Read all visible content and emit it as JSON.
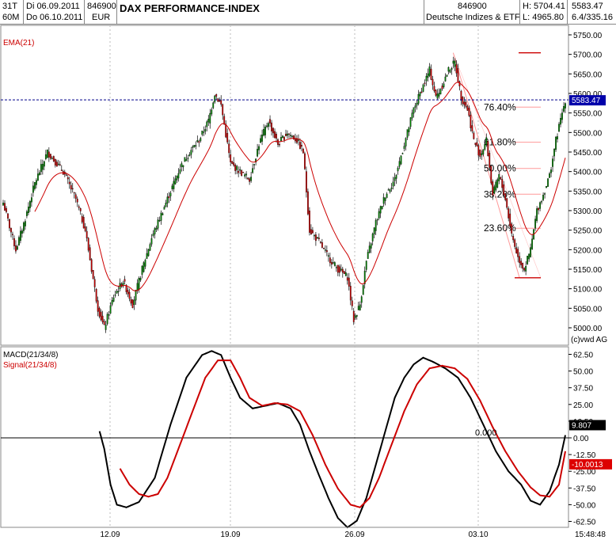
{
  "header": {
    "period": "31T",
    "interval": "60M",
    "date_from": "Di 06.09.2011",
    "date_to": "Do 06.10.2011",
    "wkn_top": "846900",
    "currency": "EUR",
    "title": "DAX PERFORMANCE-INDEX",
    "wkn_right": "846900",
    "group": "Deutsche Indizes & ETF",
    "high": "H: 5704.41",
    "low": "L: 4965.80",
    "close_top": "5583.47",
    "change": "6.4/335.16"
  },
  "copyright": "(c)vwd AG",
  "time": "15:48:48",
  "colors": {
    "up": "#008000",
    "down": "#cc0000",
    "ema": "#cc0000",
    "macd": "#000000",
    "signal": "#cc0000",
    "fib": "#ff9999",
    "last_bg": "#0000aa",
    "signal_bg": "#dd0000"
  },
  "chart_data": [
    {
      "type": "candlestick",
      "title": "DAX PERFORMANCE-INDEX",
      "ylim": [
        4950,
        5800
      ],
      "y_ticks": [
        "5750.00",
        "5700.00",
        "5650.00",
        "5600.00",
        "5550.00",
        "5500.00",
        "5450.00",
        "5400.00",
        "5350.00",
        "5300.00",
        "5250.00",
        "5200.00",
        "5150.00",
        "5100.00",
        "5050.00",
        "5000.00"
      ],
      "x_ticks": [
        "12.09",
        "19.09",
        "26.09",
        "03.10"
      ],
      "series": [
        {
          "name": "EMA(21)",
          "type": "line"
        }
      ],
      "last_price": "5583.47",
      "fibonacci": [
        {
          "label": "76.40%",
          "value": 5565
        },
        {
          "label": "61.80%",
          "value": 5475
        },
        {
          "label": "50.00%",
          "value": 5408
        },
        {
          "label": "38.20%",
          "value": 5342
        },
        {
          "label": "23.60%",
          "value": 5255
        }
      ],
      "fib_high": 5704,
      "fib_low": 5128,
      "anchors": [
        [
          0,
          5320
        ],
        [
          8,
          5200
        ],
        [
          14,
          5280
        ],
        [
          20,
          5370
        ],
        [
          28,
          5450
        ],
        [
          38,
          5400
        ],
        [
          46,
          5330
        ],
        [
          52,
          5250
        ],
        [
          56,
          5150
        ],
        [
          60,
          5050
        ],
        [
          64,
          5000
        ],
        [
          70,
          5080
        ],
        [
          76,
          5120
        ],
        [
          82,
          5060
        ],
        [
          88,
          5150
        ],
        [
          94,
          5230
        ],
        [
          100,
          5290
        ],
        [
          106,
          5350
        ],
        [
          112,
          5410
        ],
        [
          118,
          5450
        ],
        [
          124,
          5480
        ],
        [
          130,
          5530
        ],
        [
          134,
          5600
        ],
        [
          138,
          5570
        ],
        [
          144,
          5420
        ],
        [
          150,
          5400
        ],
        [
          156,
          5380
        ],
        [
          162,
          5470
        ],
        [
          168,
          5530
        ],
        [
          174,
          5470
        ],
        [
          180,
          5500
        ],
        [
          186,
          5480
        ],
        [
          190,
          5450
        ],
        [
          194,
          5250
        ],
        [
          200,
          5220
        ],
        [
          206,
          5180
        ],
        [
          212,
          5150
        ],
        [
          218,
          5130
        ],
        [
          222,
          5020
        ],
        [
          226,
          5060
        ],
        [
          230,
          5170
        ],
        [
          236,
          5270
        ],
        [
          242,
          5340
        ],
        [
          248,
          5380
        ],
        [
          254,
          5470
        ],
        [
          260,
          5560
        ],
        [
          266,
          5620
        ],
        [
          270,
          5660
        ],
        [
          274,
          5590
        ],
        [
          278,
          5620
        ],
        [
          282,
          5660
        ],
        [
          286,
          5680
        ],
        [
          290,
          5590
        ],
        [
          294,
          5560
        ],
        [
          298,
          5480
        ],
        [
          302,
          5440
        ],
        [
          306,
          5480
        ],
        [
          310,
          5340
        ],
        [
          314,
          5390
        ],
        [
          318,
          5330
        ],
        [
          322,
          5240
        ],
        [
          326,
          5180
        ],
        [
          330,
          5150
        ],
        [
          334,
          5200
        ],
        [
          338,
          5300
        ],
        [
          342,
          5340
        ],
        [
          346,
          5390
        ],
        [
          350,
          5480
        ],
        [
          354,
          5550
        ],
        [
          356,
          5583.47
        ]
      ]
    },
    {
      "type": "line",
      "ylim": [
        -68,
        68
      ],
      "y_ticks": [
        "62.50",
        "50.00",
        "37.50",
        "25.00",
        "12.50",
        "0.00",
        "-12.50",
        "-25.00",
        "-37.50",
        "-50.00",
        "-62.50"
      ],
      "zero_label": "0.000",
      "series": [
        {
          "name": "MACD(21/34/8)",
          "last": "9.807"
        },
        {
          "name": "Signal(21/34/8)",
          "last": "-10.0013"
        }
      ],
      "macd_anchors": [
        [
          61,
          5
        ],
        [
          64,
          -8
        ],
        [
          68,
          -35
        ],
        [
          72,
          -50
        ],
        [
          78,
          -52
        ],
        [
          86,
          -48
        ],
        [
          96,
          -30
        ],
        [
          106,
          10
        ],
        [
          116,
          45
        ],
        [
          126,
          62
        ],
        [
          132,
          65
        ],
        [
          138,
          62
        ],
        [
          144,
          45
        ],
        [
          150,
          30
        ],
        [
          158,
          22
        ],
        [
          166,
          24
        ],
        [
          174,
          26
        ],
        [
          182,
          22
        ],
        [
          188,
          10
        ],
        [
          194,
          -10
        ],
        [
          200,
          -28
        ],
        [
          206,
          -45
        ],
        [
          212,
          -60
        ],
        [
          218,
          -67
        ],
        [
          224,
          -62
        ],
        [
          230,
          -45
        ],
        [
          236,
          -20
        ],
        [
          242,
          5
        ],
        [
          248,
          30
        ],
        [
          254,
          45
        ],
        [
          260,
          55
        ],
        [
          266,
          60
        ],
        [
          272,
          57
        ],
        [
          280,
          52
        ],
        [
          288,
          45
        ],
        [
          296,
          30
        ],
        [
          304,
          10
        ],
        [
          312,
          -10
        ],
        [
          320,
          -25
        ],
        [
          328,
          -35
        ],
        [
          334,
          -47
        ],
        [
          340,
          -50
        ],
        [
          346,
          -40
        ],
        [
          352,
          -20
        ],
        [
          356,
          2
        ]
      ],
      "signal_anchors": [
        [
          74,
          -23
        ],
        [
          80,
          -35
        ],
        [
          86,
          -42
        ],
        [
          92,
          -44
        ],
        [
          98,
          -42
        ],
        [
          104,
          -30
        ],
        [
          112,
          -5
        ],
        [
          120,
          20
        ],
        [
          128,
          45
        ],
        [
          136,
          58
        ],
        [
          144,
          58
        ],
        [
          150,
          45
        ],
        [
          156,
          30
        ],
        [
          164,
          24
        ],
        [
          172,
          26
        ],
        [
          180,
          25
        ],
        [
          188,
          20
        ],
        [
          196,
          2
        ],
        [
          204,
          -20
        ],
        [
          212,
          -38
        ],
        [
          220,
          -50
        ],
        [
          226,
          -52
        ],
        [
          232,
          -45
        ],
        [
          238,
          -30
        ],
        [
          246,
          -5
        ],
        [
          254,
          20
        ],
        [
          262,
          40
        ],
        [
          270,
          52
        ],
        [
          278,
          54
        ],
        [
          286,
          52
        ],
        [
          294,
          44
        ],
        [
          302,
          28
        ],
        [
          310,
          8
        ],
        [
          318,
          -10
        ],
        [
          326,
          -25
        ],
        [
          334,
          -37
        ],
        [
          340,
          -43
        ],
        [
          346,
          -44
        ],
        [
          352,
          -35
        ],
        [
          356,
          -10
        ]
      ]
    }
  ]
}
